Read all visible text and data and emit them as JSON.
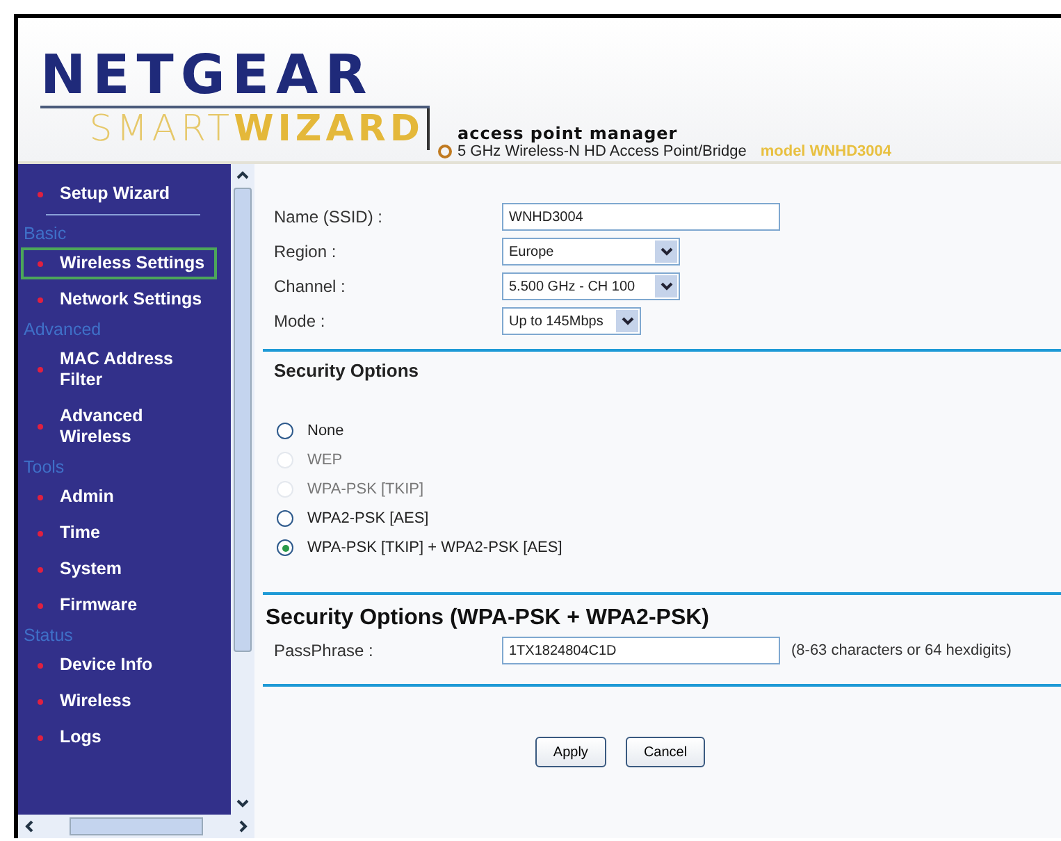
{
  "header": {
    "logo": "NETGEAR",
    "logo_smart": "SMART",
    "logo_wizard": "WIZARD",
    "product": "access point manager",
    "subtitle": "5 GHz Wireless-N HD Access Point/Bridge",
    "model": "model WNHD3004"
  },
  "sidebar": {
    "items": [
      {
        "kind": "link",
        "label": "Setup Wizard",
        "selected": false
      },
      {
        "kind": "divider"
      },
      {
        "kind": "heading",
        "label": "Basic"
      },
      {
        "kind": "link",
        "label": "Wireless Settings",
        "selected": true
      },
      {
        "kind": "link",
        "label": "Network Settings",
        "selected": false
      },
      {
        "kind": "heading",
        "label": "Advanced"
      },
      {
        "kind": "link",
        "label": "MAC Address Filter",
        "selected": false
      },
      {
        "kind": "link",
        "label": "Advanced Wireless",
        "selected": false
      },
      {
        "kind": "heading",
        "label": "Tools"
      },
      {
        "kind": "link",
        "label": "Admin",
        "selected": false
      },
      {
        "kind": "link",
        "label": "Time",
        "selected": false
      },
      {
        "kind": "link",
        "label": "System",
        "selected": false
      },
      {
        "kind": "link",
        "label": "Firmware",
        "selected": false
      },
      {
        "kind": "heading",
        "label": "Status"
      },
      {
        "kind": "link",
        "label": "Device Info",
        "selected": false
      },
      {
        "kind": "link",
        "label": "Wireless",
        "selected": false
      },
      {
        "kind": "link",
        "label": "Logs",
        "selected": false
      }
    ]
  },
  "settings": [
    {
      "kind": "text",
      "label": "Name (SSID) :",
      "value": "WNHD3004"
    },
    {
      "kind": "select",
      "label": "Region :",
      "value": "Europe"
    },
    {
      "kind": "select",
      "label": "Channel :",
      "value": "5.500 GHz - CH 100"
    },
    {
      "kind": "select",
      "label": "Mode :",
      "value": "Up to 145Mbps"
    }
  ],
  "security": {
    "title": "Security Options",
    "options": [
      {
        "label": "None",
        "selected": false,
        "disabled": false
      },
      {
        "label": "WEP",
        "selected": false,
        "disabled": true
      },
      {
        "label": "WPA-PSK [TKIP]",
        "selected": false,
        "disabled": true
      },
      {
        "label": "WPA2-PSK [AES]",
        "selected": false,
        "disabled": false
      },
      {
        "label": "WPA-PSK [TKIP] + WPA2-PSK [AES]",
        "selected": true,
        "disabled": false
      }
    ]
  },
  "passphrase_section": {
    "title": "Security Options (WPA-PSK + WPA2-PSK)",
    "label": "PassPhrase :",
    "value": "1TX1824804C1D",
    "hint": "(8-63 characters or 64 hexdigits)"
  },
  "buttons": [
    "Apply",
    "Cancel"
  ]
}
